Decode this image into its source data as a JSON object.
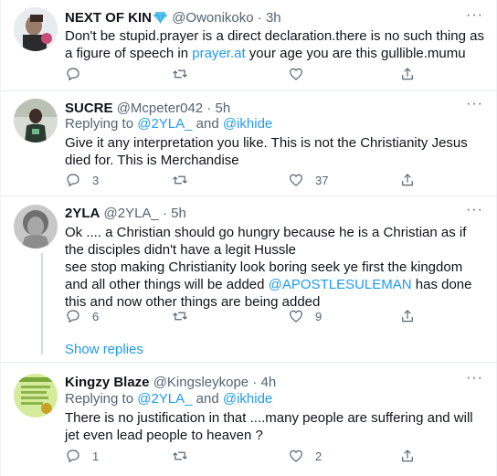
{
  "tweets": [
    {
      "name": "NEXT OF KIN",
      "handle": "@Owonikoko",
      "time": "3h",
      "text_before_link": "Don't be stupid.prayer is a direct declaration.there is no such thing as a figure of speech in ",
      "link": "prayer.at",
      "text_after_link": " your age you are this gullible.mumu",
      "replies": "",
      "retweets": "",
      "likes": ""
    },
    {
      "name": "SUCRE",
      "handle": "@Mcpeter042",
      "time": "5h",
      "replying_prefix": "Replying to ",
      "replying_user1": "@2YLA_",
      "replying_and": " and ",
      "replying_user2": "@ikhide",
      "text": "Give it any interpretation you like. This is not the Christianity Jesus died for. This is  Merchandise",
      "replies": "3",
      "retweets": "",
      "likes": "37"
    },
    {
      "name": "2YLA",
      "handle": "@2YLA_",
      "time": "5h",
      "text_line1": "Ok .... a Christian should go hungry because he is a Christian as if the disciples didn't have a legit Hussle",
      "text_line2_before": "see stop making Christianity look boring seek ye first the kingdom and all other things will be added ",
      "mention": "@APOSTLESULEMAN",
      "text_line2_after": " has done this and now other things are being added",
      "replies": "6",
      "retweets": "",
      "likes": "9",
      "show_replies": "Show replies"
    },
    {
      "name": "Kingzy Blaze",
      "handle": "@Kingsleykope",
      "time": "4h",
      "replying_prefix": "Replying to ",
      "replying_user1": "@2YLA_",
      "replying_and": " and ",
      "replying_user2": "@ikhide",
      "text": "There is no justification in that ....many people are suffering and will jet even lead people to heaven ?",
      "replies": "1",
      "retweets": "",
      "likes": "2"
    }
  ],
  "separator_dot": "·",
  "more_glyph": "···",
  "colors": {
    "accent": "#1d9bf0",
    "secondary_text": "#536471",
    "verified_diamond": "#5ec8f2"
  }
}
